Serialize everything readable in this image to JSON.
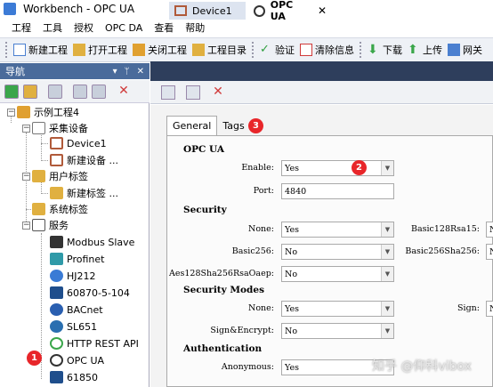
{
  "window": {
    "title": "Workbench - OPC UA"
  },
  "menu": [
    "工程",
    "工具",
    "授权",
    "OPC DA",
    "查看",
    "帮助"
  ],
  "toolbar": [
    {
      "label": "新建工程",
      "icon": "new-project-icon",
      "color": "#4a7fd0"
    },
    {
      "label": "打开工程",
      "icon": "open-folder-icon",
      "color": "#e0b040"
    },
    {
      "label": "关闭工程",
      "icon": "close-project-icon",
      "color": "#e0a030"
    },
    {
      "label": "工程目录",
      "icon": "directory-icon",
      "color": "#e0b040"
    },
    {
      "label": "验证",
      "icon": "check-icon",
      "color": "#2e9e3e"
    },
    {
      "label": "清除信息",
      "icon": "clear-icon",
      "color": "#d03a3a"
    },
    {
      "label": "下载",
      "icon": "download-arrow-icon",
      "color": "#3aa64a"
    },
    {
      "label": "上传",
      "icon": "upload-arrow-icon",
      "color": "#3aa64a"
    },
    {
      "label": "网关",
      "icon": "gateway-icon",
      "color": "#4a7fd0"
    }
  ],
  "nav": {
    "title": "导航",
    "controls": [
      "▾",
      "ᛘ",
      "✕"
    ]
  },
  "tree": [
    {
      "label": "示例工程4",
      "icon": "project-icon",
      "color": "#e0a030"
    },
    {
      "label": "采集设备",
      "icon": "device-group-icon",
      "color": "#777777"
    },
    {
      "label": "Device1",
      "icon": "device-grid-icon",
      "color": "#b05a3a"
    },
    {
      "label": "新建设备 ...",
      "icon": "new-device-icon",
      "color": "#b05a3a"
    },
    {
      "label": "用户标签",
      "icon": "user-tag-folder-icon",
      "color": "#e0b040"
    },
    {
      "label": "新建标签 ...",
      "icon": "new-tag-icon",
      "color": "#e0b040"
    },
    {
      "label": "系统标签",
      "icon": "system-tag-icon",
      "color": "#e0b040"
    },
    {
      "label": "服务",
      "icon": "service-icon",
      "color": "#555555"
    },
    {
      "label": "Modbus Slave",
      "icon": "modbus-icon",
      "color": "#333333"
    },
    {
      "label": "Profinet",
      "icon": "profinet-icon",
      "color": "#2f9aa8"
    },
    {
      "label": "HJ212",
      "icon": "hj212-icon",
      "color": "#3a7bd5"
    },
    {
      "label": "60870-5-104",
      "icon": "iec-icon",
      "color": "#1f4e8c"
    },
    {
      "label": "BACnet",
      "icon": "bacnet-icon",
      "color": "#2a5fb0"
    },
    {
      "label": "SL651",
      "icon": "sl651-icon",
      "color": "#2a6fb0"
    },
    {
      "label": "HTTP REST API",
      "icon": "http-icon",
      "color": "#3aa64a"
    },
    {
      "label": "OPC UA",
      "icon": "opcua-icon",
      "color": "#333333"
    },
    {
      "label": "61850",
      "icon": "iec61850-icon",
      "color": "#1f4e8c"
    }
  ],
  "tabs": [
    {
      "label": "Device1"
    },
    {
      "label": "OPC UA",
      "close": "✕"
    }
  ],
  "panel": {
    "tabs": [
      "General",
      "Tags"
    ],
    "sections": {
      "opcua": "OPC UA",
      "security": "Security",
      "security_modes": "Security Modes",
      "auth": "Authentication"
    },
    "enable": {
      "label": "Enable:",
      "value": "Yes"
    },
    "port": {
      "label": "Port:",
      "value": "4840"
    },
    "none": {
      "label": "None:",
      "value": "Yes"
    },
    "basic128": {
      "label": "Basic128Rsa15:",
      "value": "N"
    },
    "basic256": {
      "label": "Basic256:",
      "value": "No"
    },
    "basic256sha": {
      "label": "Basic256Sha256:",
      "value": "N"
    },
    "aes": {
      "label": "Aes128Sha256RsaOaep:",
      "value": "No"
    },
    "mode_none": {
      "label": "None:",
      "value": "Yes"
    },
    "sign": {
      "label": "Sign:",
      "value": "N"
    },
    "sign_encrypt": {
      "label": "Sign&Encrypt:",
      "value": "No"
    },
    "anonymous": {
      "label": "Anonymous:",
      "value": "Yes"
    }
  },
  "badges": [
    "1",
    "2",
    "3"
  ],
  "watermark": "知乎 @仰科vibox"
}
